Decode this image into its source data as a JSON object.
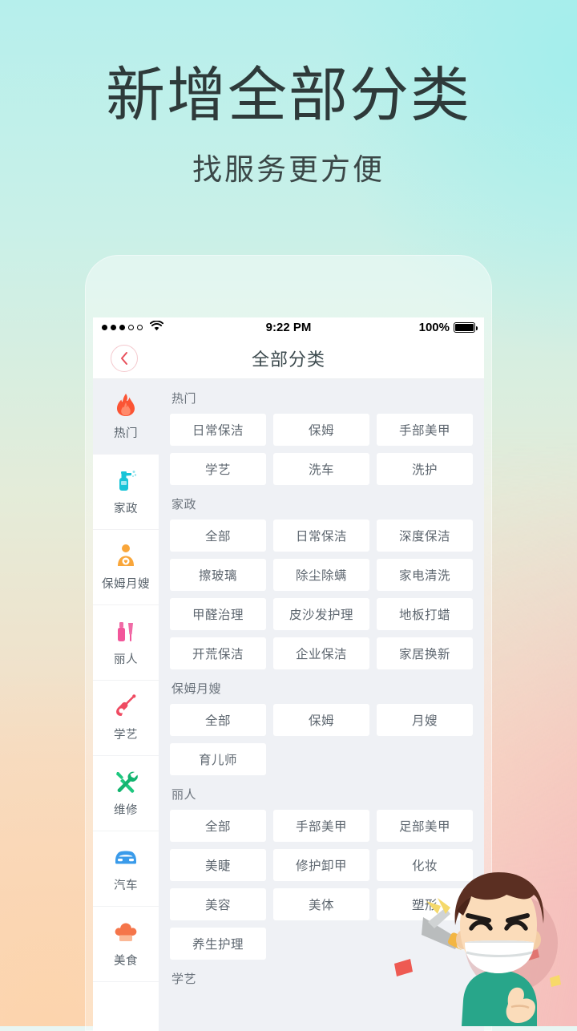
{
  "promo": {
    "headline": "新增全部分类",
    "subhead": "找服务更方便"
  },
  "colors": {
    "bg_top_left": "#b6efec",
    "bg_top_right": "#acefec",
    "bg_bottom_left": "#fbd6bb",
    "bg_bottom_right": "#f4b9bc",
    "accent_pink": "#f4c9ce",
    "chevron": "#e8505b",
    "panel_bg": "#eff1f5",
    "chip_bg": "#ffffff",
    "text_primary": "#3c4a4e",
    "text_secondary": "#5d666f",
    "section_title": "#6b737c"
  },
  "statusbar": {
    "signal_filled": 3,
    "signal_total": 5,
    "wifi_icon": "wifi-icon",
    "time": "9:22 PM",
    "battery_percent": "100%",
    "battery_level": 100
  },
  "navbar": {
    "back_icon": "chevron-left-icon",
    "title": "全部分类"
  },
  "sidebar": {
    "items": [
      {
        "label": "热门",
        "icon": "flame-icon",
        "color": "#fb5434",
        "active": true
      },
      {
        "label": "家政",
        "icon": "spray-bottle-icon",
        "color": "#19c4d8",
        "active": false
      },
      {
        "label": "保姆月嫂",
        "icon": "nursing-icon",
        "color": "#f9a63a",
        "active": false
      },
      {
        "label": "丽人",
        "icon": "nail-polish-icon",
        "color": "#f2569a",
        "active": false
      },
      {
        "label": "学艺",
        "icon": "guitar-icon",
        "color": "#ef4b62",
        "active": false
      },
      {
        "label": "维修",
        "icon": "tools-icon",
        "color": "#1ec77f",
        "active": false
      },
      {
        "label": "汽车",
        "icon": "car-icon",
        "color": "#3a9bea",
        "active": false
      },
      {
        "label": "美食",
        "icon": "chef-hat-icon",
        "color": "#f5754a",
        "active": false
      }
    ]
  },
  "panel": {
    "sections": [
      {
        "title": "热门",
        "items": [
          "日常保洁",
          "保姆",
          "手部美甲",
          "学艺",
          "洗车",
          "洗护"
        ]
      },
      {
        "title": "家政",
        "items": [
          "全部",
          "日常保洁",
          "深度保洁",
          "擦玻璃",
          "除尘除螨",
          "家电清洗",
          "甲醛治理",
          "皮沙发护理",
          "地板打蜡",
          "开荒保洁",
          "企业保洁",
          "家居换新"
        ]
      },
      {
        "title": "保姆月嫂",
        "items": [
          "全部",
          "保姆",
          "月嫂",
          "育儿师"
        ]
      },
      {
        "title": "丽人",
        "items": [
          "全部",
          "手部美甲",
          "足部美甲",
          "美睫",
          "修护卸甲",
          "化妆",
          "美容",
          "美体",
          "塑形",
          "养生护理"
        ]
      },
      {
        "title": "学艺",
        "items": []
      }
    ]
  },
  "decoration": {
    "character": "celebrating-boy-with-party-popper",
    "confetti": "confetti-pieces"
  }
}
